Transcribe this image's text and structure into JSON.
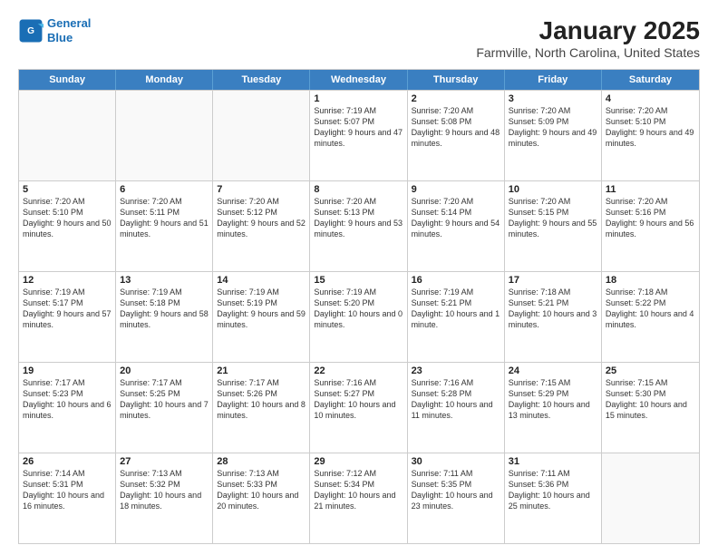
{
  "logo": {
    "line1": "General",
    "line2": "Blue"
  },
  "title": "January 2025",
  "subtitle": "Farmville, North Carolina, United States",
  "days_of_week": [
    "Sunday",
    "Monday",
    "Tuesday",
    "Wednesday",
    "Thursday",
    "Friday",
    "Saturday"
  ],
  "weeks": [
    [
      {
        "day": "",
        "info": ""
      },
      {
        "day": "",
        "info": ""
      },
      {
        "day": "",
        "info": ""
      },
      {
        "day": "1",
        "info": "Sunrise: 7:19 AM\nSunset: 5:07 PM\nDaylight: 9 hours and 47 minutes."
      },
      {
        "day": "2",
        "info": "Sunrise: 7:20 AM\nSunset: 5:08 PM\nDaylight: 9 hours and 48 minutes."
      },
      {
        "day": "3",
        "info": "Sunrise: 7:20 AM\nSunset: 5:09 PM\nDaylight: 9 hours and 49 minutes."
      },
      {
        "day": "4",
        "info": "Sunrise: 7:20 AM\nSunset: 5:10 PM\nDaylight: 9 hours and 49 minutes."
      }
    ],
    [
      {
        "day": "5",
        "info": "Sunrise: 7:20 AM\nSunset: 5:10 PM\nDaylight: 9 hours and 50 minutes."
      },
      {
        "day": "6",
        "info": "Sunrise: 7:20 AM\nSunset: 5:11 PM\nDaylight: 9 hours and 51 minutes."
      },
      {
        "day": "7",
        "info": "Sunrise: 7:20 AM\nSunset: 5:12 PM\nDaylight: 9 hours and 52 minutes."
      },
      {
        "day": "8",
        "info": "Sunrise: 7:20 AM\nSunset: 5:13 PM\nDaylight: 9 hours and 53 minutes."
      },
      {
        "day": "9",
        "info": "Sunrise: 7:20 AM\nSunset: 5:14 PM\nDaylight: 9 hours and 54 minutes."
      },
      {
        "day": "10",
        "info": "Sunrise: 7:20 AM\nSunset: 5:15 PM\nDaylight: 9 hours and 55 minutes."
      },
      {
        "day": "11",
        "info": "Sunrise: 7:20 AM\nSunset: 5:16 PM\nDaylight: 9 hours and 56 minutes."
      }
    ],
    [
      {
        "day": "12",
        "info": "Sunrise: 7:19 AM\nSunset: 5:17 PM\nDaylight: 9 hours and 57 minutes."
      },
      {
        "day": "13",
        "info": "Sunrise: 7:19 AM\nSunset: 5:18 PM\nDaylight: 9 hours and 58 minutes."
      },
      {
        "day": "14",
        "info": "Sunrise: 7:19 AM\nSunset: 5:19 PM\nDaylight: 9 hours and 59 minutes."
      },
      {
        "day": "15",
        "info": "Sunrise: 7:19 AM\nSunset: 5:20 PM\nDaylight: 10 hours and 0 minutes."
      },
      {
        "day": "16",
        "info": "Sunrise: 7:19 AM\nSunset: 5:21 PM\nDaylight: 10 hours and 1 minute."
      },
      {
        "day": "17",
        "info": "Sunrise: 7:18 AM\nSunset: 5:21 PM\nDaylight: 10 hours and 3 minutes."
      },
      {
        "day": "18",
        "info": "Sunrise: 7:18 AM\nSunset: 5:22 PM\nDaylight: 10 hours and 4 minutes."
      }
    ],
    [
      {
        "day": "19",
        "info": "Sunrise: 7:17 AM\nSunset: 5:23 PM\nDaylight: 10 hours and 6 minutes."
      },
      {
        "day": "20",
        "info": "Sunrise: 7:17 AM\nSunset: 5:25 PM\nDaylight: 10 hours and 7 minutes."
      },
      {
        "day": "21",
        "info": "Sunrise: 7:17 AM\nSunset: 5:26 PM\nDaylight: 10 hours and 8 minutes."
      },
      {
        "day": "22",
        "info": "Sunrise: 7:16 AM\nSunset: 5:27 PM\nDaylight: 10 hours and 10 minutes."
      },
      {
        "day": "23",
        "info": "Sunrise: 7:16 AM\nSunset: 5:28 PM\nDaylight: 10 hours and 11 minutes."
      },
      {
        "day": "24",
        "info": "Sunrise: 7:15 AM\nSunset: 5:29 PM\nDaylight: 10 hours and 13 minutes."
      },
      {
        "day": "25",
        "info": "Sunrise: 7:15 AM\nSunset: 5:30 PM\nDaylight: 10 hours and 15 minutes."
      }
    ],
    [
      {
        "day": "26",
        "info": "Sunrise: 7:14 AM\nSunset: 5:31 PM\nDaylight: 10 hours and 16 minutes."
      },
      {
        "day": "27",
        "info": "Sunrise: 7:13 AM\nSunset: 5:32 PM\nDaylight: 10 hours and 18 minutes."
      },
      {
        "day": "28",
        "info": "Sunrise: 7:13 AM\nSunset: 5:33 PM\nDaylight: 10 hours and 20 minutes."
      },
      {
        "day": "29",
        "info": "Sunrise: 7:12 AM\nSunset: 5:34 PM\nDaylight: 10 hours and 21 minutes."
      },
      {
        "day": "30",
        "info": "Sunrise: 7:11 AM\nSunset: 5:35 PM\nDaylight: 10 hours and 23 minutes."
      },
      {
        "day": "31",
        "info": "Sunrise: 7:11 AM\nSunset: 5:36 PM\nDaylight: 10 hours and 25 minutes."
      },
      {
        "day": "",
        "info": ""
      }
    ]
  ]
}
